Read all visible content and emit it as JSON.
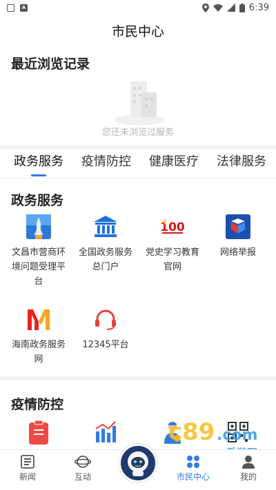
{
  "status_bar": {
    "time": "6:39"
  },
  "header": {
    "title": "市民中心"
  },
  "recent": {
    "title": "最近浏览记录",
    "empty_text": "您还未浏览过服务"
  },
  "tabs": [
    {
      "label": "政务服务",
      "active": true
    },
    {
      "label": "疫情防控",
      "active": false
    },
    {
      "label": "健康医疗",
      "active": false
    },
    {
      "label": "法律服务",
      "active": false
    }
  ],
  "gov_section": {
    "title": "政务服务",
    "items": [
      {
        "label": "文昌市营商环境问题受理平台",
        "icon": "rocket-icon"
      },
      {
        "label": "全国政务服务总门户",
        "icon": "government-building-icon"
      },
      {
        "label": "党史学习教育官网",
        "icon": "party-history-100-icon"
      },
      {
        "label": "网络举报",
        "icon": "report-shield-icon"
      },
      {
        "label": "海南政务服务网",
        "icon": "hainan-m-logo-icon"
      },
      {
        "label": "12345平台",
        "icon": "headset-icon"
      }
    ]
  },
  "epidemic_section": {
    "title": "疫情防控",
    "items": [
      {
        "icon": "clipboard-icon"
      },
      {
        "icon": "bar-chart-icon"
      },
      {
        "icon": "doctor-icon"
      },
      {
        "icon": "qr-code-icon"
      }
    ]
  },
  "tabbar": {
    "items": [
      {
        "label": "新闻",
        "icon": "news-icon"
      },
      {
        "label": "互动",
        "icon": "planet-icon"
      },
      {
        "label": "市民中心",
        "icon": "citizen-center-icon",
        "active": true
      },
      {
        "label": "我的",
        "icon": "user-icon"
      }
    ],
    "center_icon": "astronaut-mascot-icon"
  },
  "watermark": {
    "text": "手游网"
  },
  "colors": {
    "accent": "#2f7de1",
    "section_bg": "#f2f3f5"
  }
}
